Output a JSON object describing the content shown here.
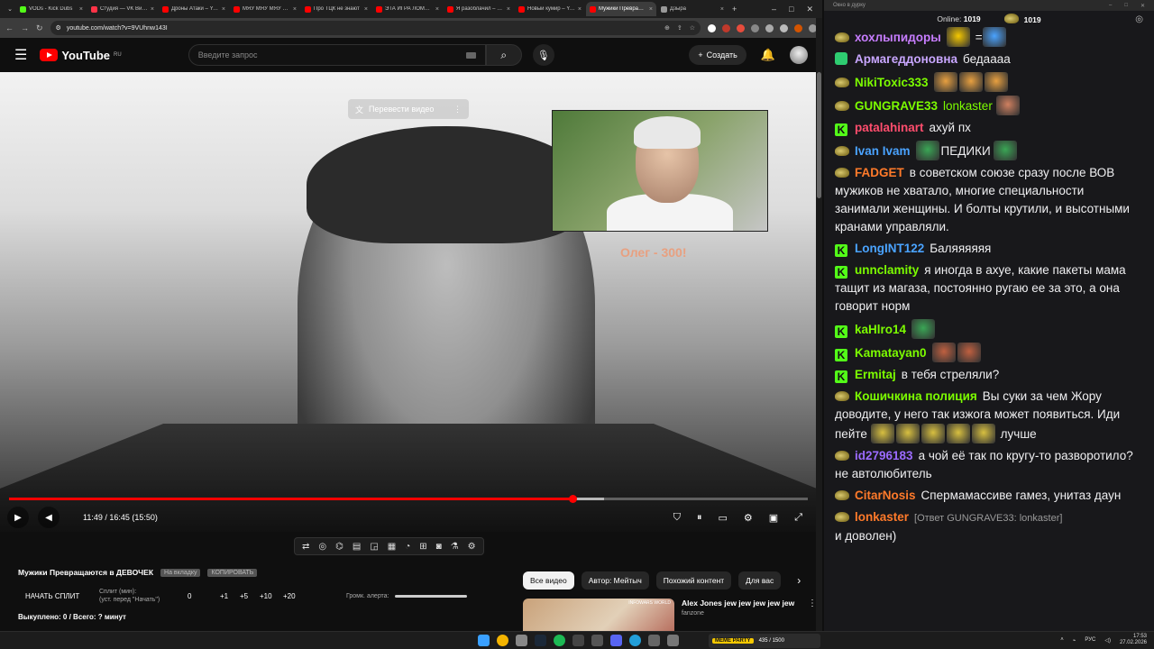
{
  "browser": {
    "tabs": [
      {
        "title": "VODs - Kick Dubs",
        "color": "#53fc18"
      },
      {
        "title": "Студия — VK Видео",
        "color": "#ff3347"
      },
      {
        "title": "Дроны Атаки – YouTube",
        "color": "#ff0000"
      },
      {
        "title": "МЯУ МЯУ МЯУ – YouTube",
        "color": "#ff0000"
      },
      {
        "title": "Про ТЦК не знают",
        "color": "#ff0000"
      },
      {
        "title": "ЭТА ИГРА ЛОМАЕТ",
        "color": "#ff0000"
      },
      {
        "title": "Я разоблачил – YouTube",
        "color": "#ff0000"
      },
      {
        "title": "Новый кумир – YouTube",
        "color": "#ff0000"
      },
      {
        "title": "Мужики Превращаются",
        "color": "#ff0000",
        "active": true
      },
      {
        "title": "Дзыра",
        "color": "#999999"
      }
    ],
    "url": "youtube.com/watch?v=9VUhnw143I"
  },
  "youtube": {
    "logo_text": "YouTube",
    "region": "RU",
    "search_placeholder": "Введите запрос",
    "create_label": "Создать"
  },
  "player": {
    "translate_label": "Перевести видео",
    "overlay_text": "Олег - 300!",
    "time_text": "11:49 / 16:45 (15:50)",
    "progress_played": 0.705,
    "progress_buffered": 0.745
  },
  "split": {
    "title": "Мужики Превращаются в ДЕВОЧЕК",
    "tag_1": "На вкладку",
    "tag_2": "КОПИРОВАТЬ",
    "start_label": "НАЧАТЬ СПЛИТ",
    "min_label": "Сплит (мин):",
    "min_hint": "(уст. перед \"Начать\")",
    "value": "0",
    "increments": [
      "+1",
      "+5",
      "+10",
      "+20"
    ],
    "alert_label": "Громк. алерта:",
    "footer": "Выкуплено: 0 / Всего: ? минут"
  },
  "chips": [
    "Все видео",
    "Автор: Мейтыч",
    "Похожий контент",
    "Для вас"
  ],
  "recommendation": {
    "title": "Alex Jones jew jew jew jew jew",
    "channel": "fanzone",
    "thumb_badge": "INFOWARS WORLD"
  },
  "chat": {
    "window_title": "Окно в дурку",
    "online_label": "Online:",
    "online_count": "1019",
    "viewers_count": "1019",
    "messages": [
      {
        "badge": "pepe",
        "user": "хохлыпидоры",
        "color": "#c77dff",
        "text": "",
        "emotes": [
          "#f5c800",
          "#4aa3ff"
        ],
        "suffix": "="
      },
      {
        "badge": "shield",
        "user": "Армагеддоновна",
        "color": "#c8a6ff",
        "text": "бедаааа"
      },
      {
        "badge": "pepe",
        "user": "NikiToxic333",
        "color": "#7cfc00",
        "text": "",
        "emotes": [
          "#e8a040",
          "#e8a040",
          "#e8a040"
        ]
      },
      {
        "badge": "pepe",
        "user": "GUNGRAVE33",
        "color": "#7cfc00",
        "text": "lonkaster",
        "text_color": "#7cfc00",
        "emotes": [
          "#d08060"
        ]
      },
      {
        "badge": "k",
        "user": "patalahinart",
        "color": "#ff4d6d",
        "text": "ахуй пх"
      },
      {
        "badge": "pepe",
        "user": "Ivan Ivam",
        "color": "#4aa3ff",
        "text": "ПЕДИКИ",
        "emotes_before": [
          "#3aa655"
        ],
        "emotes": [
          "#3aa655"
        ]
      },
      {
        "badge": "pepe",
        "user": "FADGET",
        "color": "#ff7a2a",
        "text": "в советском союзе сразу после ВОВ мужиков не хватало, многие специальности занимали женщины. И болты крутили, и высотными кранами управляли."
      },
      {
        "badge": "k",
        "user": "LongINT122",
        "color": "#4aa3ff",
        "text": "Баляяяяяя"
      },
      {
        "badge": "k",
        "user": "unnclamity",
        "color": "#7cfc00",
        "text": "я иногда в ахуе, какие пакеты мама тащит из магаза, постоянно ругаю ее за это, а она говорит норм"
      },
      {
        "badge": "k",
        "user": "kaHlro14",
        "color": "#7cfc00",
        "text": "",
        "emotes": [
          "#3aa655"
        ]
      },
      {
        "badge": "k",
        "user": "Kamatayan0",
        "color": "#7cfc00",
        "text": "",
        "emotes": [
          "#c06040",
          "#c06040"
        ]
      },
      {
        "badge": "k",
        "user": "Ermitaj",
        "color": "#7cfc00",
        "text": "в тебя стреляли?"
      },
      {
        "badge": "pepe",
        "user": "Кошичкина полиция",
        "color": "#7cfc00",
        "text": "Вы суки за чем Жору доводите, у него так изжога может появиться. Иди пейте",
        "emotes": [
          "#d8c040",
          "#d8c040",
          "#d8c040",
          "#d8c040",
          "#d8c040"
        ],
        "suffix": "лучше"
      },
      {
        "badge": "pepe",
        "user": "id2796183",
        "color": "#9b6bff",
        "text": "а чой её так по кругу-то разворотило? не автолюбитель"
      },
      {
        "badge": "pepe",
        "user": "CitarNosis",
        "color": "#ff7a2a",
        "text": "Спермамассиве гамез, унитаз даун"
      },
      {
        "badge": "pepe",
        "user": "lonkaster",
        "color": "#ff7a2a",
        "reply": "[Ответ GUNGRAVE33: lonkaster]",
        "text": "и доволен)"
      }
    ]
  },
  "taskbar": {
    "widget_title": "MEME PARTY",
    "widget_counter": "435 / 1500",
    "lang": "РУС",
    "time": "17:53",
    "date": "27.02.2026"
  }
}
